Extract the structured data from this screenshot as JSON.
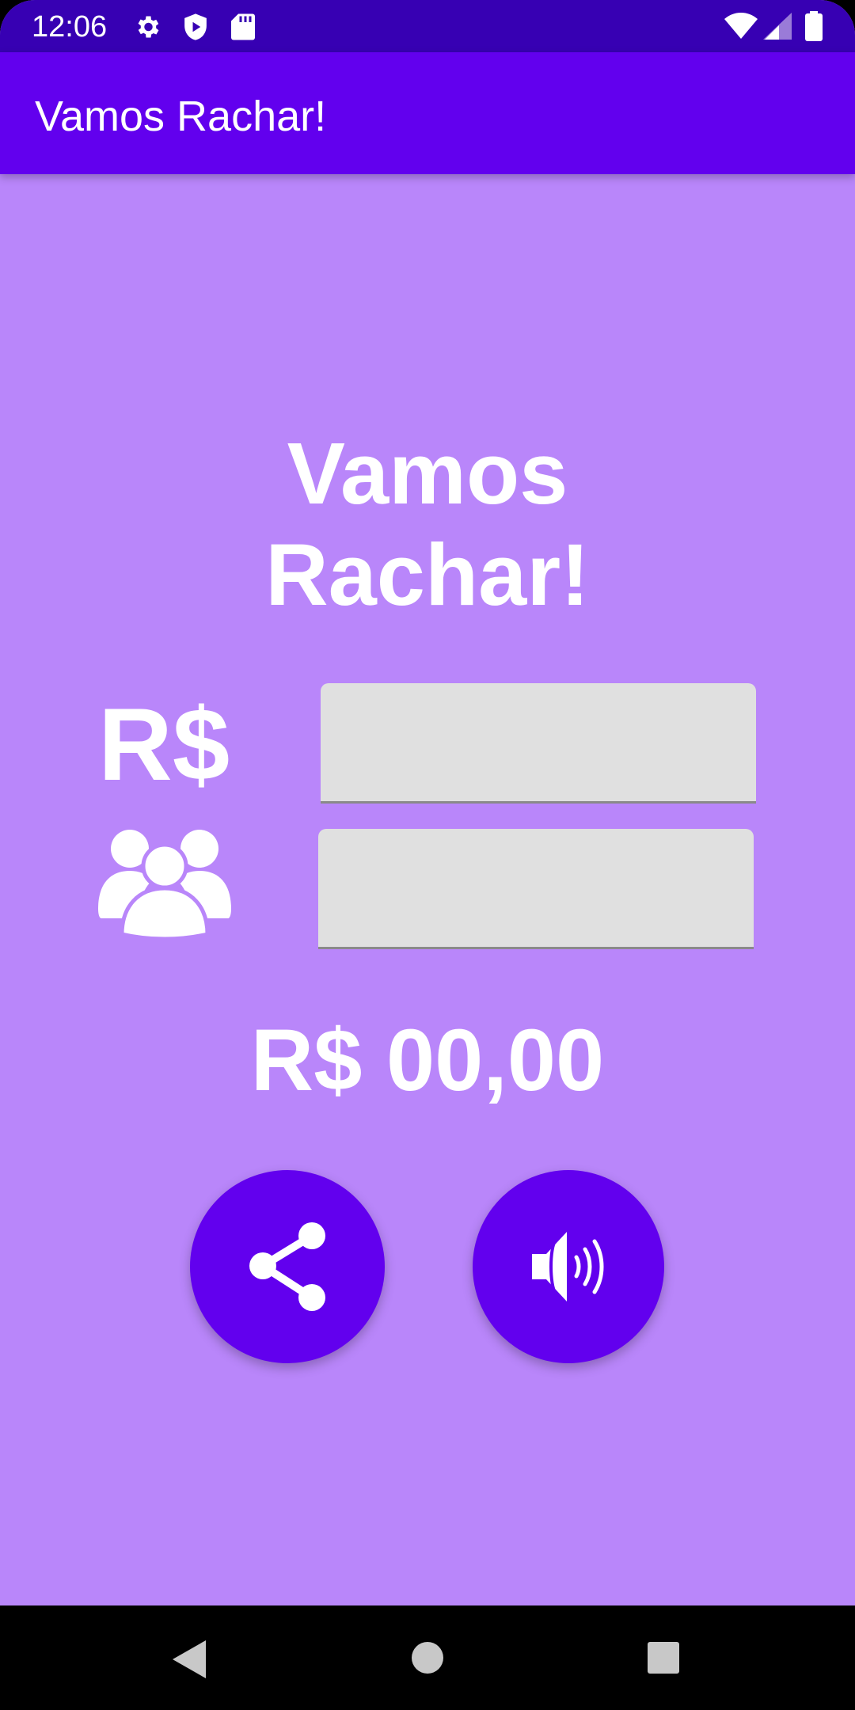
{
  "status_bar": {
    "time": "12:06",
    "left_icons": [
      "gear-icon",
      "shield-play-icon",
      "sd-card-icon"
    ],
    "right_icons": [
      "wifi-icon",
      "cell-signal-icon",
      "battery-icon"
    ]
  },
  "app_bar": {
    "title": "Vamos Rachar!"
  },
  "main": {
    "headline_line1": "Vamos",
    "headline_line2": "Rachar!",
    "currency_label": "R$",
    "amount_input": {
      "value": "",
      "placeholder": ""
    },
    "people_input": {
      "value": "",
      "placeholder": ""
    },
    "people_icon": "people-group-icon",
    "result": "R$ 00,00",
    "share_button_icon": "share-icon",
    "speak_button_icon": "speaker-icon"
  },
  "nav_bar": {
    "buttons": [
      "back-icon",
      "home-icon",
      "recents-icon"
    ]
  },
  "colors": {
    "status_bar": "#3700B3",
    "app_bar": "#6200EE",
    "background": "#B986FA",
    "fab": "#6200EE",
    "input": "#E0E0E0",
    "text": "#FFFFFF"
  }
}
